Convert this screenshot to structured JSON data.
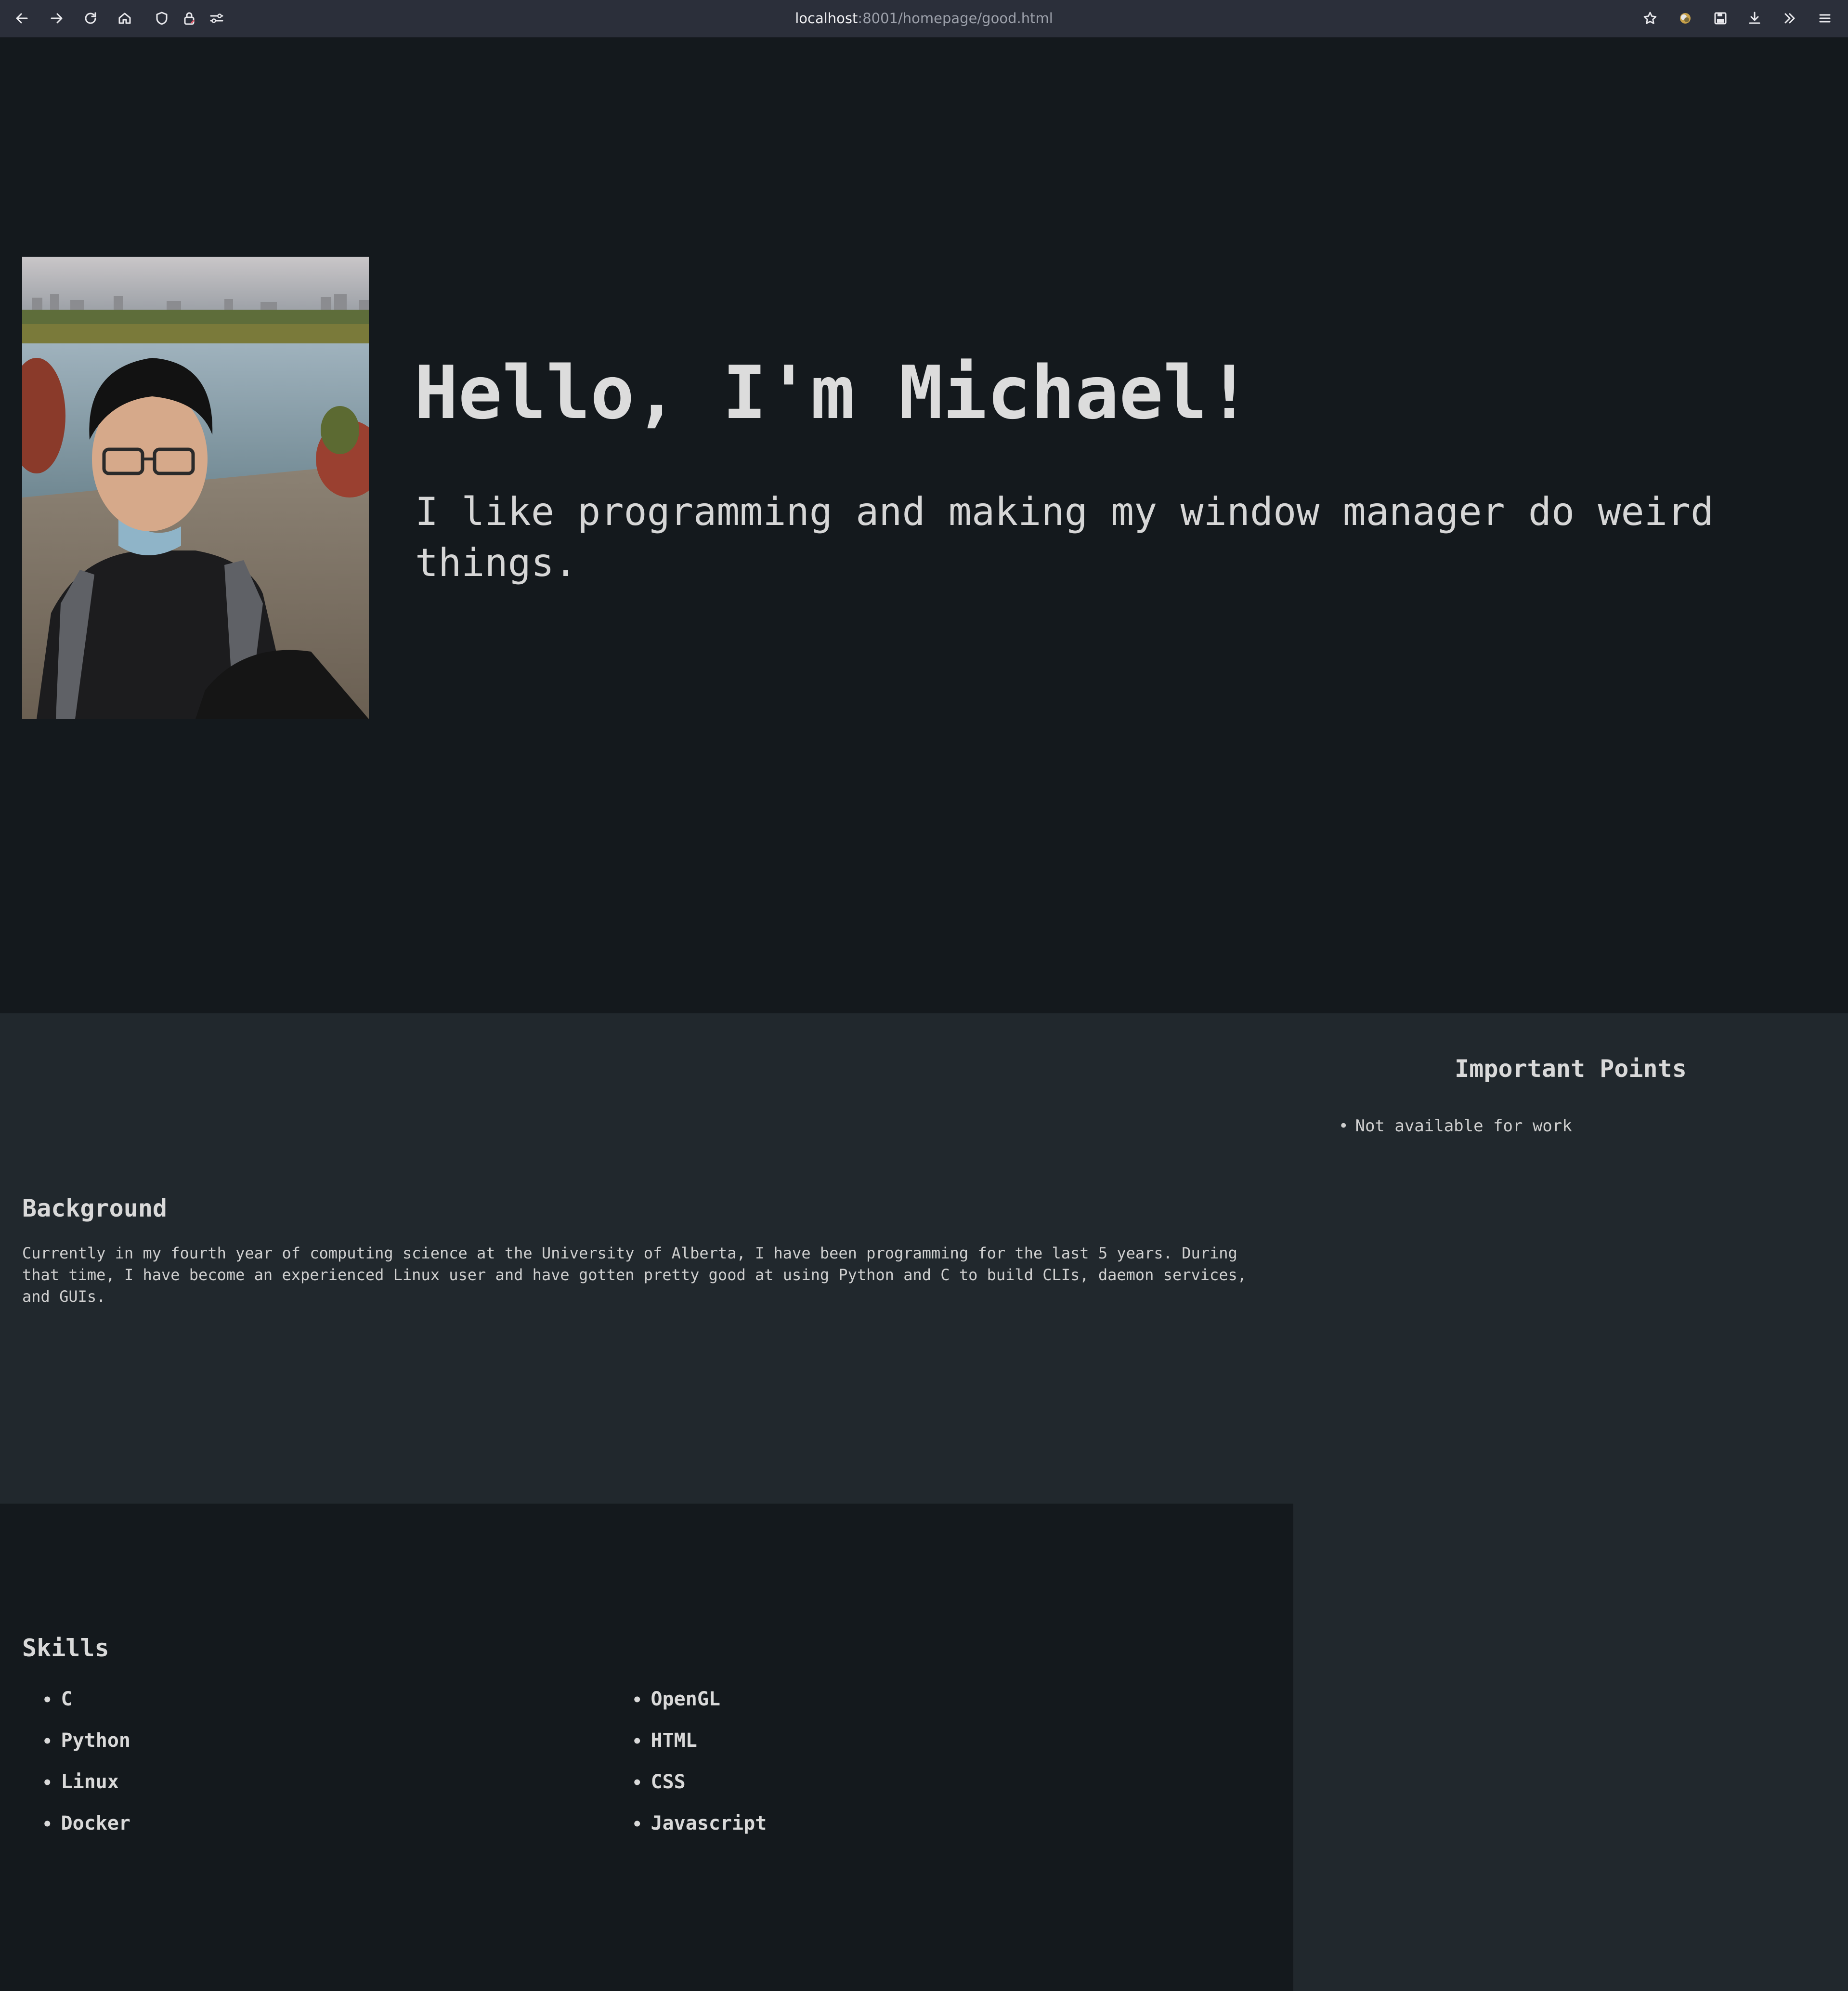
{
  "browser": {
    "url_host": "localhost",
    "url_path": ":8001/homepage/good.html"
  },
  "hero": {
    "title": "Hello, I'm Michael!",
    "subtitle": "I like programming and making my window manager do weird things.",
    "photo_alt": "Portrait photo of Michael by a river"
  },
  "background": {
    "title": "Background",
    "text": "Currently in my fourth year of computing science at the University of Alberta, I have been programming for the last 5 years. During that time, I have become an experienced Linux user and have gotten pretty good at using Python and C to build CLIs, daemon services, and GUIs."
  },
  "important": {
    "title": "Important Points",
    "items": [
      "Not available for work"
    ]
  },
  "skills": {
    "title": "Skills",
    "column_a": [
      "C",
      "Python",
      "Linux",
      "Docker"
    ],
    "column_b": [
      "OpenGL",
      "HTML",
      "CSS",
      "Javascript"
    ]
  },
  "icons": {
    "back": "arrow-left-icon",
    "forward": "arrow-right-icon",
    "reload": "reload-icon",
    "home": "home-icon",
    "shield": "shield-icon",
    "lock": "lock-icon",
    "permissions": "sliders-icon",
    "bookmark": "star-icon",
    "account": "account-icon",
    "save": "save-icon",
    "downloads": "download-icon",
    "more": "chevrons-right-icon",
    "menu": "hamburger-menu-icon"
  },
  "colors": {
    "hero_bg": "#14191d",
    "panel_bg": "#21282d",
    "toolbar_bg": "#2b2f3a",
    "text": "#d9d9d9"
  }
}
